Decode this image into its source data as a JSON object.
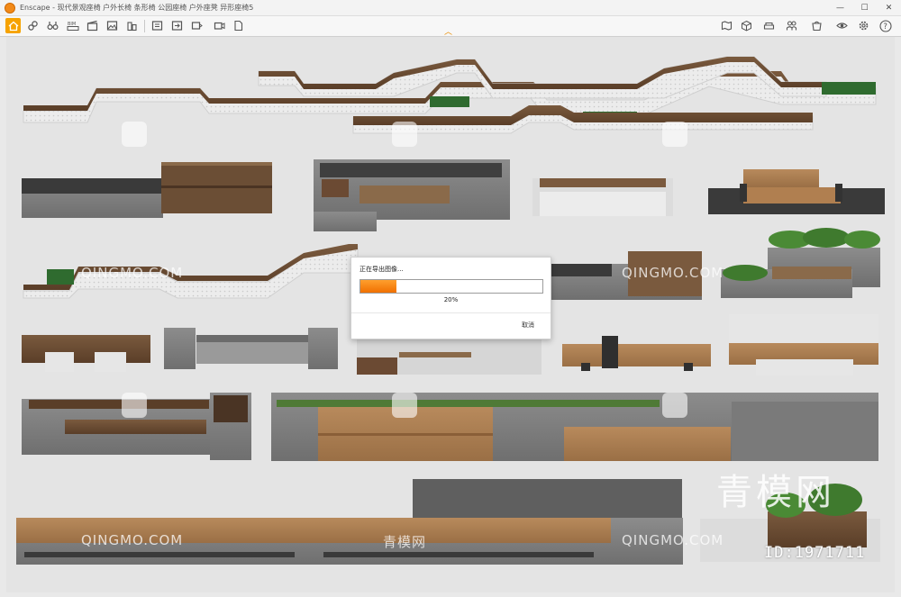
{
  "window": {
    "title": "Enscape - 现代景观座椅 户外长椅 条形椅 公园座椅 户外座凳 异形座椅5",
    "minimize": "—",
    "maximize": "☐",
    "close": "✕"
  },
  "toolbar": {
    "left_icons": [
      "home-icon",
      "link-icon",
      "binoculars-icon",
      "bim-icon",
      "clapper-icon",
      "image-icon",
      "people-icon",
      "buildings-icon",
      "folder-icon",
      "box-icon",
      "render-settings-icon",
      "export-image-icon",
      "screenshot-icon",
      "batch-export-icon",
      "video-export-icon",
      "export-file-icon"
    ],
    "right_icons": [
      "map-icon",
      "cube-icon",
      "sofa-icon",
      "people-settings-icon",
      "asset-library-icon",
      "view-icon",
      "settings-icon",
      "help-icon"
    ],
    "help_label": "?",
    "accent_color": "#f6a200"
  },
  "dialog": {
    "title": "正在导出图像...",
    "progress": 0.2,
    "percent_label": "20%",
    "cancel_label": "取消",
    "fill_color": "#f07000"
  },
  "watermarks": {
    "site_text": "QINGMO.COM",
    "cn_text": "青模网",
    "big_text": "青模网",
    "id_text": "ID:1971711"
  }
}
